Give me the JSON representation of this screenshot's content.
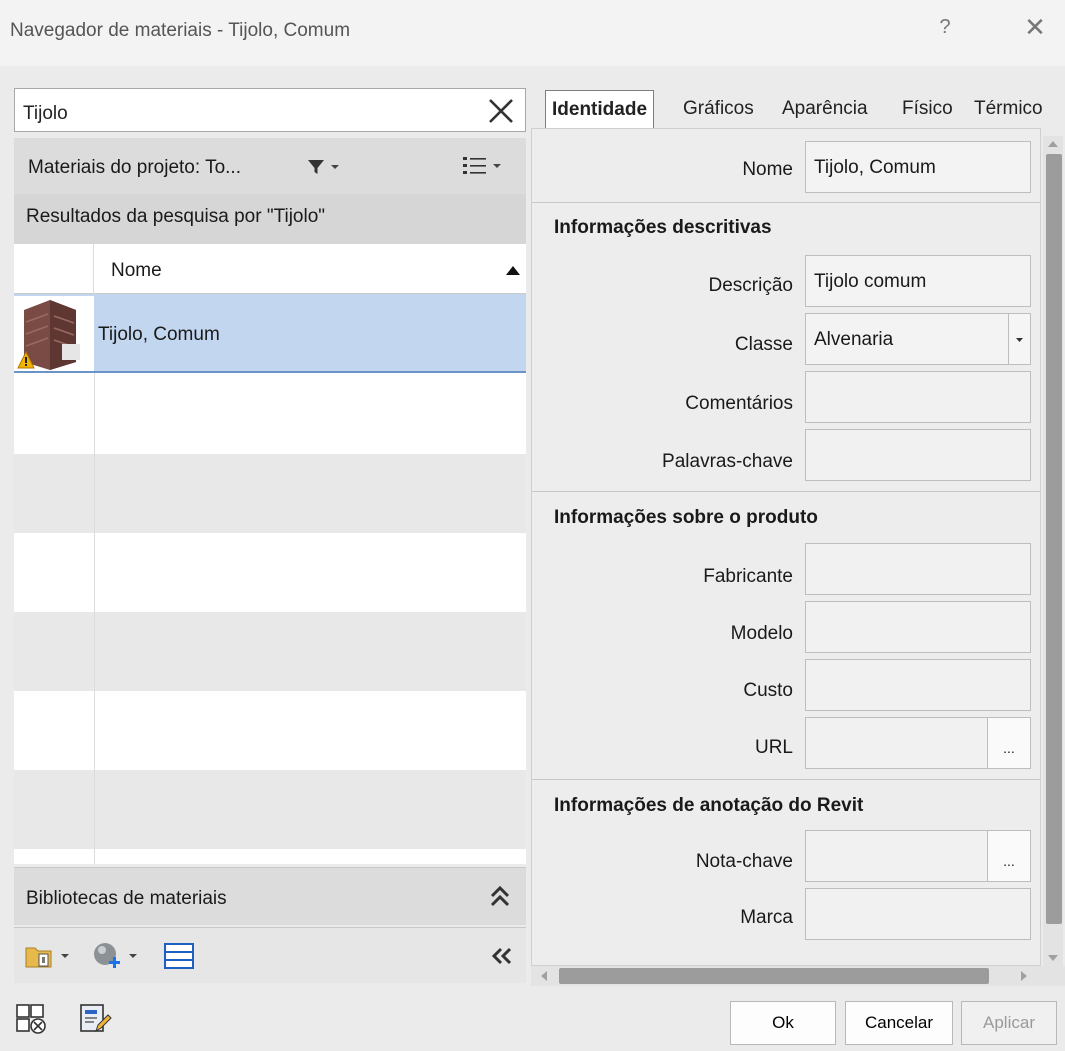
{
  "window": {
    "title": "Navegador de materiais - Tijolo, Comum",
    "help_label": "?",
    "close_label": "✕"
  },
  "search": {
    "value": "Tijolo",
    "clear_icon": "close-icon"
  },
  "project_filter": {
    "label": "Materiais do projeto: To...",
    "filter_icon": "filter-icon",
    "view_icon": "list-view-icon"
  },
  "results": {
    "label": "Resultados da pesquisa por \"Tijolo\""
  },
  "table": {
    "column_name": "Nome",
    "rows": [
      {
        "name": "Tijolo, Comum",
        "selected": true
      }
    ]
  },
  "libraries": {
    "label": "Bibliotecas de materiais"
  },
  "tabs": [
    {
      "label": "Identidade",
      "active": true
    },
    {
      "label": "Gráficos",
      "active": false
    },
    {
      "label": "Aparência",
      "active": false
    },
    {
      "label": "Físico",
      "active": false
    },
    {
      "label": "Térmico",
      "active": false
    }
  ],
  "identity": {
    "name_label": "Nome",
    "name_value": "Tijolo, Comum",
    "descriptive_section": "Informações descritivas",
    "description_label": "Descrição",
    "description_value": "Tijolo comum",
    "class_label": "Classe",
    "class_value": "Alvenaria",
    "comments_label": "Comentários",
    "comments_value": "",
    "keywords_label": "Palavras-chave",
    "keywords_value": "",
    "product_section": "Informações sobre o produto",
    "manufacturer_label": "Fabricante",
    "manufacturer_value": "",
    "model_label": "Modelo",
    "model_value": "",
    "cost_label": "Custo",
    "cost_value": "",
    "url_label": "URL",
    "url_value": "",
    "revit_section": "Informações de anotação do Revit",
    "keynote_label": "Nota-chave",
    "keynote_value": "",
    "mark_label": "Marca",
    "mark_value": "",
    "ellipsis": "..."
  },
  "footer": {
    "ok_label": "Ok",
    "cancel_label": "Cancelar",
    "apply_label": "Aplicar"
  },
  "colors": {
    "selection": "#c3d6ef",
    "selection_border": "#6c93c8",
    "panel": "#ebebeb"
  }
}
